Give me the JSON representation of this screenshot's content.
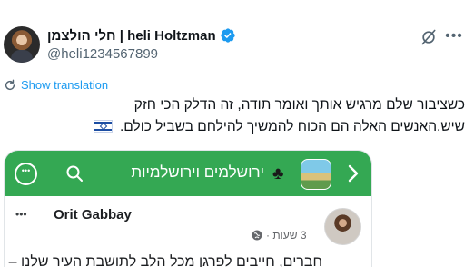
{
  "author": {
    "display_name": "חלי הולצמן | heli Holtzman",
    "handle": "@heli1234567899",
    "verified": true
  },
  "actions": {
    "grok_icon": "grok-icon",
    "more_label": "•••"
  },
  "translate": {
    "label": "Show translation"
  },
  "tweet": {
    "line1": "כשציבור שלם מרגיש אותך ואומר תודה, זה הדלק הכי חזק",
    "line2": "שיש.האנשים האלה הם הכוח להמשיך להילחם בשביל כולם."
  },
  "embed": {
    "group_name": "ירושלמים וירושלמיות",
    "club_symbol": "♣",
    "post": {
      "author": "Orit Gabbay",
      "time": "3 שעות ·",
      "text_partial": "חברים, חייבים לפרגן מכל הלב לתושבת העיר שלנו –"
    }
  },
  "colors": {
    "accent": "#1d9bf0",
    "group_bar": "#34a853",
    "text": "#0f1419",
    "muted": "#536471"
  }
}
